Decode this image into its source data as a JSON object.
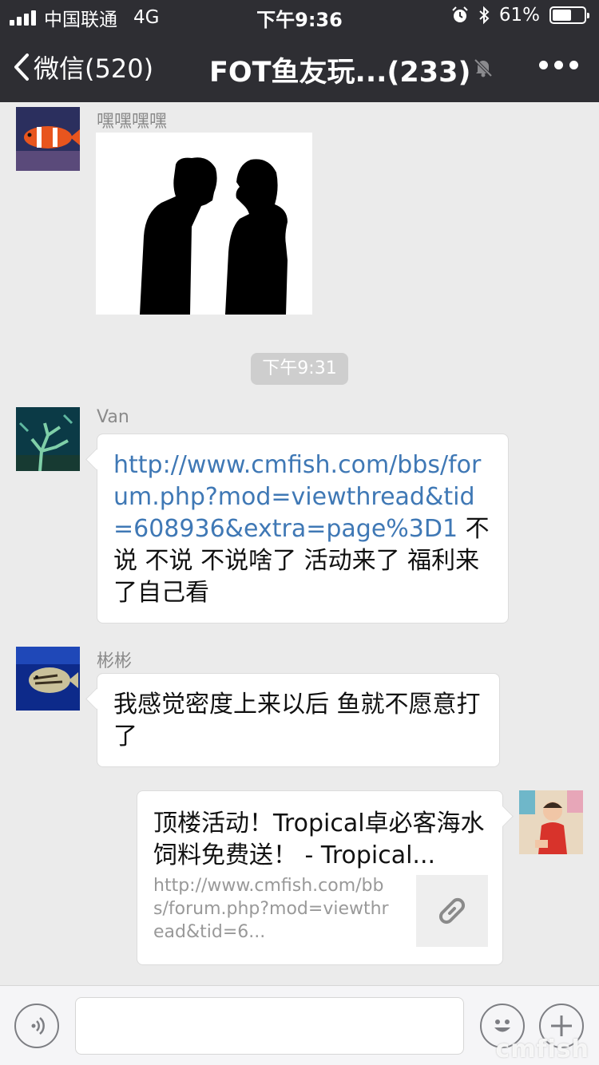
{
  "status_bar": {
    "carrier": "中国联通",
    "network": "4G",
    "time": "下午9:36",
    "battery_percent": "61%",
    "battery_level": 0.61
  },
  "nav": {
    "back_label": "微信(520)",
    "title": "FOT鱼友玩...(233)",
    "icons": [
      "chevron-left-icon",
      "mute-bell-icon",
      "more-icon"
    ]
  },
  "messages": {
    "m1": {
      "sender": "嘿嘿嘿嘿",
      "type": "image",
      "avatar": "clownfish-avatar"
    },
    "timestamp": "下午9:31",
    "m2": {
      "sender": "Van",
      "link": "http://www.cmfish.com/bbs/forum.php?mod=viewthread&tid=608936&extra=page%3D1",
      "text": " 不说  不说  不说啥了 活动来了 福利来了自己看",
      "avatar": "coral-avatar"
    },
    "m3": {
      "sender": "彬彬",
      "text": "我感觉密度上来以后 鱼就不愿意打了",
      "avatar": "angelfish-avatar"
    },
    "m4": {
      "card_title": "顶楼活动！Tropical卓必客海水饲料免费送！ - Tropical...",
      "card_url": "http://www.cmfish.com/bbs/forum.php?mod=viewthread&tid=6...",
      "thumb_icon": "link-icon",
      "avatar": "child-avatar"
    }
  },
  "input_bar": {
    "icons": [
      "voice-icon",
      "emoji-icon",
      "plus-icon"
    ]
  },
  "watermark": "cmfish"
}
